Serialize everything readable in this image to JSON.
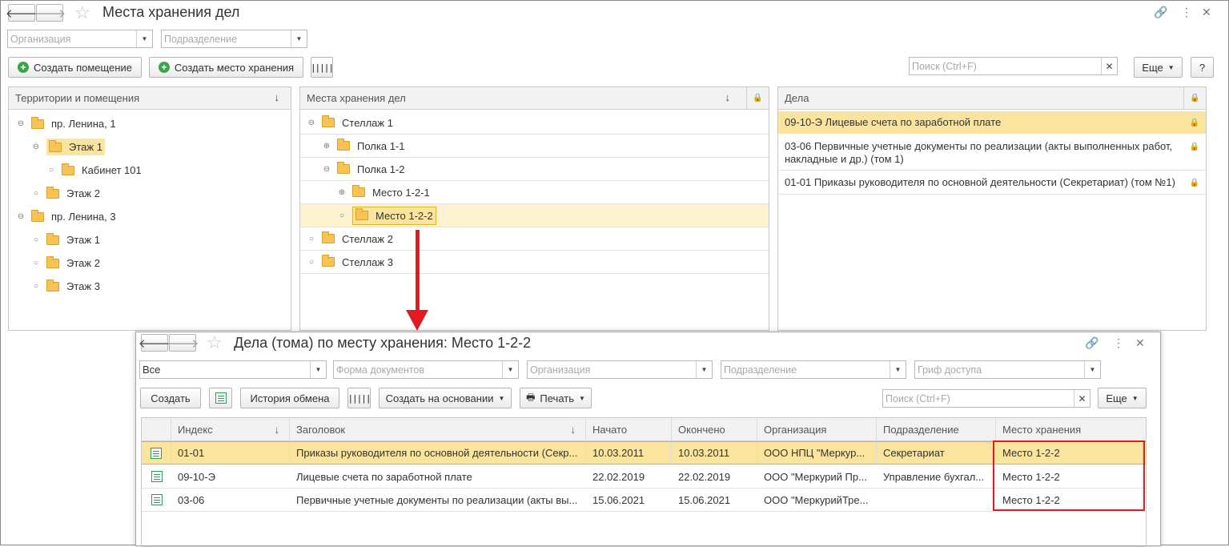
{
  "main": {
    "title": "Места хранения дел",
    "filters": {
      "organization_placeholder": "Организация",
      "department_placeholder": "Подразделение"
    },
    "toolbar": {
      "create_room": "Создать помещение",
      "create_storage": "Создать место хранения",
      "search_placeholder": "Поиск (Ctrl+F)",
      "more": "Еще",
      "help": "?"
    },
    "territories": {
      "header": "Территории и помещения",
      "items": [
        {
          "label": "пр. Ленина, 1"
        },
        {
          "label": "Этаж 1"
        },
        {
          "label": "Кабинет 101"
        },
        {
          "label": "Этаж 2"
        },
        {
          "label": "пр. Ленина, 3"
        },
        {
          "label": "Этаж 1"
        },
        {
          "label": "Этаж 2"
        },
        {
          "label": "Этаж 3"
        }
      ]
    },
    "storage": {
      "header": "Места хранения дел",
      "items": [
        {
          "label": "Стеллаж 1"
        },
        {
          "label": "Полка 1-1"
        },
        {
          "label": "Полка 1-2"
        },
        {
          "label": "Место 1-2-1"
        },
        {
          "label": "Место 1-2-2"
        },
        {
          "label": "Стеллаж 2"
        },
        {
          "label": "Стеллаж 3"
        }
      ]
    },
    "cases": {
      "header": "Дела",
      "items": [
        {
          "label": "09-10-Э Лицевые счета по заработной плате"
        },
        {
          "label": "03-06 Первичные учетные документы по реализации (акты выполненных работ, накладные и др.) (том 1)"
        },
        {
          "label": "01-01 Приказы руководителя по основной деятельности (Секретариат) (том №1)"
        }
      ]
    }
  },
  "sub": {
    "title": "Дела (тома) по месту хранения: Место 1-2-2",
    "filters": {
      "scope_value": "Все",
      "doc_form_placeholder": "Форма документов",
      "organization_placeholder": "Организация",
      "department_placeholder": "Подразделение",
      "access_placeholder": "Гриф доступа"
    },
    "toolbar": {
      "create": "Создать",
      "history": "История обмена",
      "create_based": "Создать на основании",
      "print": "Печать",
      "search_placeholder": "Поиск (Ctrl+F)",
      "more": "Еще"
    },
    "columns": {
      "index": "Индекс",
      "title": "Заголовок",
      "start": "Начато",
      "end": "Окончено",
      "org": "Организация",
      "dept": "Подразделение",
      "place": "Место хранения"
    },
    "rows": [
      {
        "index": "01-01",
        "title": "Приказы руководителя по основной деятельности (Секр...",
        "start": "10.03.2011",
        "end": "10.03.2011",
        "org": "ООО НПЦ \"Меркур...",
        "dept": "Секретариат",
        "place": "Место 1-2-2"
      },
      {
        "index": "09-10-Э",
        "title": "Лицевые счета по заработной плате",
        "start": "22.02.2019",
        "end": "22.02.2019",
        "org": "ООО \"Меркурий Пр...",
        "dept": "Управление бухгал...",
        "place": "Место 1-2-2"
      },
      {
        "index": "03-06",
        "title": "Первичные учетные документы по реализации (акты вы...",
        "start": "15.06.2021",
        "end": "15.06.2021",
        "org": "ООО \"МеркурийТре...",
        "dept": "",
        "place": "Место 1-2-2"
      }
    ]
  }
}
